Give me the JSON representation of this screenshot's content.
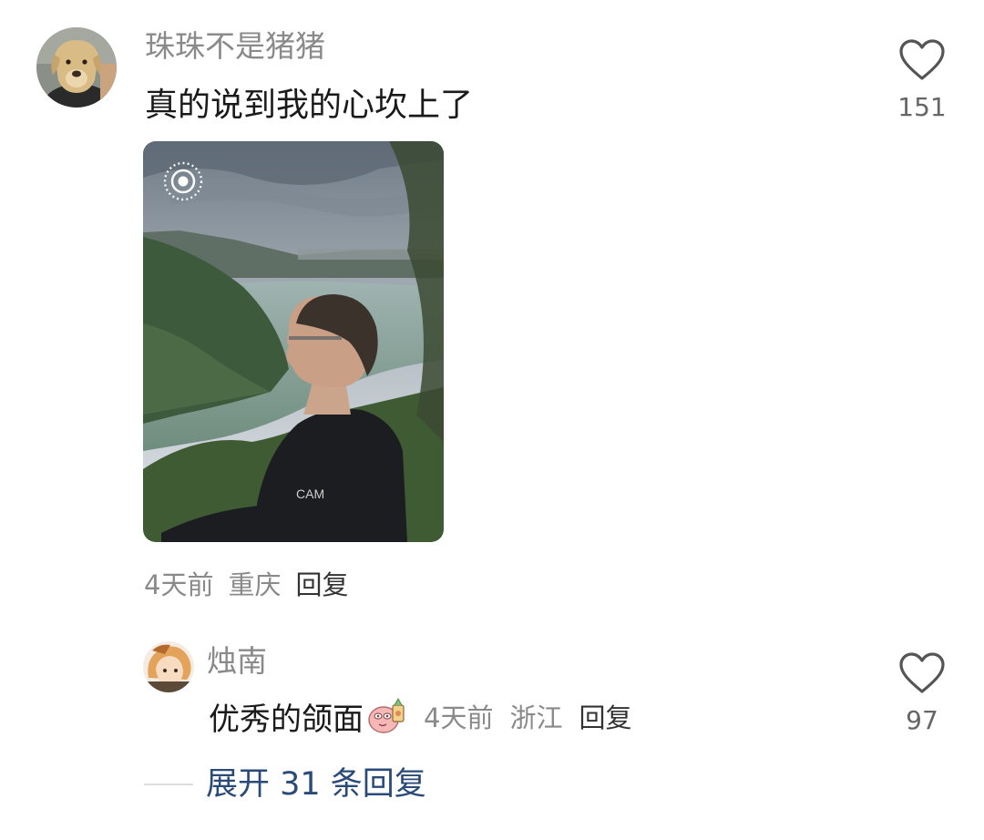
{
  "comment": {
    "username": "珠珠不是猪猪",
    "text": "真的说到我的心坎上了",
    "likes": "151",
    "time": "4天前",
    "location": "重庆",
    "reply_label": "回复"
  },
  "reply": {
    "username": "烛南",
    "text": "优秀的颌面",
    "likes": "97",
    "time": "4天前",
    "location": "浙江",
    "reply_label": "回复"
  },
  "expand": {
    "label": "展开 31 条回复"
  },
  "icons": {
    "like": "heart-outline-icon",
    "live_photo": "live-photo-icon",
    "sticker": "emoji-sticker-icon"
  },
  "colors": {
    "username": "#8a8a8a",
    "meta": "#8a8a8a",
    "expand_link": "#2a4a78",
    "like_stroke": "#555555"
  }
}
